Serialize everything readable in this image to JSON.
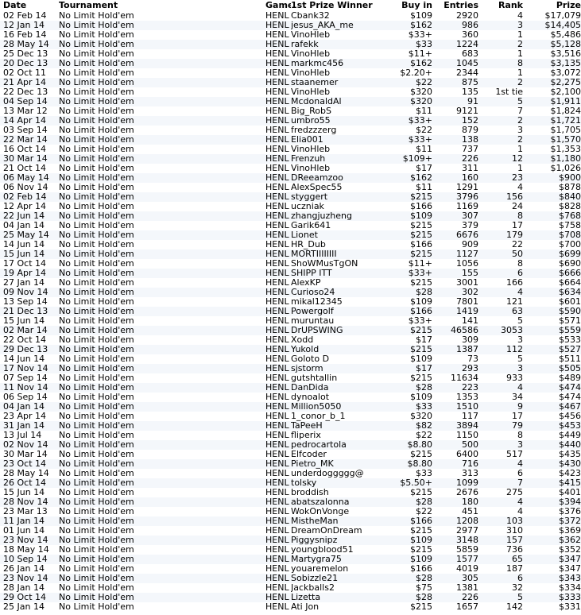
{
  "columns": [
    "Date",
    "Tournament",
    "Game",
    "1st Prize Winner",
    "Buy in",
    "Entries",
    "Rank",
    "Prize"
  ],
  "rows": [
    [
      "02 Feb 14",
      "No Limit Hold'em",
      "HENL",
      "Cbank32",
      "$109",
      "2920",
      "4",
      "$17,079"
    ],
    [
      "12 Jan 14",
      "No Limit Hold'em",
      "HENL",
      "jesus_AKA_me",
      "$162",
      "986",
      "3",
      "$14,405"
    ],
    [
      "16 Feb 14",
      "No Limit Hold'em",
      "HENL",
      "VinoHleb",
      "$33+",
      "360",
      "1",
      "$5,486"
    ],
    [
      "28 May 14",
      "No Limit Hold'em",
      "HENL",
      "rafekk",
      "$33",
      "1224",
      "2",
      "$5,128"
    ],
    [
      "25 Dec 13",
      "No Limit Hold'em",
      "HENL",
      "VinoHleb",
      "$11+",
      "683",
      "1",
      "$3,516"
    ],
    [
      "20 Dec 13",
      "No Limit Hold'em",
      "HENL",
      "markmc456",
      "$162",
      "1045",
      "8",
      "$3,135"
    ],
    [
      "02 Oct 11",
      "No Limit Hold'em",
      "HENL",
      "VinoHleb",
      "$2.20+",
      "2344",
      "1",
      "$3,072"
    ],
    [
      "21 Apr 14",
      "No Limit Hold'em",
      "HENL",
      "staanemer",
      "$22",
      "875",
      "2",
      "$2,275"
    ],
    [
      "22 Dec 13",
      "No Limit Hold'em",
      "HENL",
      "VinoHleb",
      "$320",
      "135",
      "1st tie",
      "$2,100"
    ],
    [
      "04 Sep 14",
      "No Limit Hold'em",
      "HENL",
      "McdonaldAl",
      "$320",
      "91",
      "5",
      "$1,911"
    ],
    [
      "13 Mar 12",
      "No Limit Hold'em",
      "HENL",
      "Big_RobS",
      "$11",
      "9121",
      "7",
      "$1,824"
    ],
    [
      "14 Apr 14",
      "No Limit Hold'em",
      "HENL",
      "umbro55",
      "$33+",
      "152",
      "2",
      "$1,721"
    ],
    [
      "03 Sep 14",
      "No Limit Hold'em",
      "HENL",
      "fredzzzerg",
      "$22",
      "879",
      "3",
      "$1,705"
    ],
    [
      "22 Mar 14",
      "No Limit Hold'em",
      "HENL",
      "Elia001",
      "$33+",
      "138",
      "2",
      "$1,570"
    ],
    [
      "16 Oct 14",
      "No Limit Hold'em",
      "HENL",
      "VinoHleb",
      "$11",
      "737",
      "1",
      "$1,353"
    ],
    [
      "30 Mar 14",
      "No Limit Hold'em",
      "HENL",
      "Frenzuh",
      "$109+",
      "226",
      "12",
      "$1,180"
    ],
    [
      "21 Oct 14",
      "No Limit Hold'em",
      "HENL",
      "VinoHleb",
      "$17",
      "311",
      "1",
      "$1,026"
    ],
    [
      "06 May 14",
      "No Limit Hold'em",
      "HENL",
      "DReeamzoo",
      "$162",
      "160",
      "23",
      "$900"
    ],
    [
      "06 Nov 14",
      "No Limit Hold'em",
      "HENL",
      "AlexSpec55",
      "$11",
      "1291",
      "4",
      "$878"
    ],
    [
      "02 Feb 14",
      "No Limit Hold'em",
      "HENL",
      "styggert",
      "$215",
      "3796",
      "156",
      "$840"
    ],
    [
      "12 Apr 14",
      "No Limit Hold'em",
      "HENL",
      "uczniak",
      "$166",
      "1169",
      "24",
      "$828"
    ],
    [
      "22 Jun 14",
      "No Limit Hold'em",
      "HENL",
      "zhangjuzheng",
      "$109",
      "307",
      "8",
      "$768"
    ],
    [
      "04 Jan 14",
      "No Limit Hold'em",
      "HENL",
      "Garik641",
      "$215",
      "379",
      "17",
      "$758"
    ],
    [
      "25 May 14",
      "No Limit Hold'em",
      "HENL",
      "Lionet",
      "$215",
      "6676",
      "179",
      "$708"
    ],
    [
      "14 Jun 14",
      "No Limit Hold'em",
      "HENL",
      "HR_Dub",
      "$166",
      "909",
      "22",
      "$700"
    ],
    [
      "15 Jun 14",
      "No Limit Hold'em",
      "HENL",
      "MORTIIIIIIII",
      "$215",
      "1127",
      "50",
      "$699"
    ],
    [
      "17 Oct 14",
      "No Limit Hold'em",
      "HENL",
      "ShoWMusTgON",
      "$11+",
      "1056",
      "8",
      "$690"
    ],
    [
      "19 Apr 14",
      "No Limit Hold'em",
      "HENL",
      "SHIPP ITT",
      "$33+",
      "155",
      "6",
      "$666"
    ],
    [
      "27 Jan 14",
      "No Limit Hold'em",
      "HENL",
      "AlexKP",
      "$215",
      "3001",
      "166",
      "$664"
    ],
    [
      "09 Nov 14",
      "No Limit Hold'em",
      "HENL",
      "Curioso24",
      "$28",
      "302",
      "4",
      "$634"
    ],
    [
      "13 Sep 14",
      "No Limit Hold'em",
      "HENL",
      "mikal12345",
      "$109",
      "7801",
      "121",
      "$601"
    ],
    [
      "21 Dec 13",
      "No Limit Hold'em",
      "HENL",
      "Powergolf",
      "$166",
      "1419",
      "63",
      "$590"
    ],
    [
      "15 Jun 14",
      "No Limit Hold'em",
      "HENL",
      "muruntau",
      "$33+",
      "141",
      "5",
      "$571"
    ],
    [
      "02 Mar 14",
      "No Limit Hold'em",
      "HENL",
      "DrUPSWING",
      "$215",
      "46586",
      "3053",
      "$559"
    ],
    [
      "22 Oct 14",
      "No Limit Hold'em",
      "HENL",
      "Xodd",
      "$17",
      "309",
      "3",
      "$533"
    ],
    [
      "29 Dec 13",
      "No Limit Hold'em",
      "HENL",
      "Yukold",
      "$215",
      "1387",
      "112",
      "$527"
    ],
    [
      "14 Jun 14",
      "No Limit Hold'em",
      "HENL",
      "Goloto D",
      "$109",
      "73",
      "5",
      "$511"
    ],
    [
      "17 Nov 14",
      "No Limit Hold'em",
      "HENL",
      "sjstorm",
      "$17",
      "293",
      "3",
      "$505"
    ],
    [
      "07 Sep 14",
      "No Limit Hold'em",
      "HENL",
      "gutshtallin",
      "$215",
      "11634",
      "933",
      "$489"
    ],
    [
      "11 Nov 14",
      "No Limit Hold'em",
      "HENL",
      "DanDida",
      "$28",
      "223",
      "4",
      "$474"
    ],
    [
      "06 Sep 14",
      "No Limit Hold'em",
      "HENL",
      "dynoalot",
      "$109",
      "1353",
      "34",
      "$474"
    ],
    [
      "04 Jan 14",
      "No Limit Hold'em",
      "HENL",
      "Million5050",
      "$33",
      "1510",
      "9",
      "$467"
    ],
    [
      "23 Apr 14",
      "No Limit Hold'em",
      "HENL",
      "1_conor_b_1",
      "$320",
      "117",
      "17",
      "$456"
    ],
    [
      "31 Jan 14",
      "No Limit Hold'em",
      "HENL",
      "TaPeeH",
      "$82",
      "3894",
      "79",
      "$453"
    ],
    [
      "13 Jul 14",
      "No Limit Hold'em",
      "HENL",
      "fliperix",
      "$22",
      "1150",
      "8",
      "$449"
    ],
    [
      "02 Nov 14",
      "No Limit Hold'em",
      "HENL",
      "pedrocartola",
      "$8.80",
      "500",
      "3",
      "$440"
    ],
    [
      "30 Mar 14",
      "No Limit Hold'em",
      "HENL",
      "Elfcoder",
      "$215",
      "6400",
      "517",
      "$435"
    ],
    [
      "23 Oct 14",
      "No Limit Hold'em",
      "HENL",
      "Pietro_MK",
      "$8.80",
      "716",
      "4",
      "$430"
    ],
    [
      "28 May 14",
      "No Limit Hold'em",
      "HENL",
      "underdoggggg@",
      "$33",
      "313",
      "6",
      "$423"
    ],
    [
      "26 Oct 14",
      "No Limit Hold'em",
      "HENL",
      "tolsky",
      "$5.50+",
      "1099",
      "7",
      "$415"
    ],
    [
      "15 Jun 14",
      "No Limit Hold'em",
      "HENL",
      "broddish",
      "$215",
      "2676",
      "275",
      "$401"
    ],
    [
      "28 Nov 14",
      "No Limit Hold'em",
      "HENL",
      "abatszalonna",
      "$28",
      "180",
      "4",
      "$394"
    ],
    [
      "23 Mar 13",
      "No Limit Hold'em",
      "HENL",
      "WokOnVonge",
      "$22",
      "451",
      "4",
      "$376"
    ],
    [
      "11 Jan 14",
      "No Limit Hold'em",
      "HENL",
      "MistheMan",
      "$166",
      "1208",
      "103",
      "$372"
    ],
    [
      "01 Jun 14",
      "No Limit Hold'em",
      "HENL",
      "DreamOnDream",
      "$215",
      "2977",
      "310",
      "$369"
    ],
    [
      "23 Nov 14",
      "No Limit Hold'em",
      "HENL",
      "Piggysnipz",
      "$109",
      "3148",
      "157",
      "$362"
    ],
    [
      "18 May 14",
      "No Limit Hold'em",
      "HENL",
      "youngblood51",
      "$215",
      "5859",
      "736",
      "$352"
    ],
    [
      "10 Sep 14",
      "No Limit Hold'em",
      "HENL",
      "Martygra75",
      "$109",
      "1577",
      "65",
      "$347"
    ],
    [
      "26 Jan 14",
      "No Limit Hold'em",
      "HENL",
      "youaremelon",
      "$166",
      "4019",
      "187",
      "$347"
    ],
    [
      "23 Nov 14",
      "No Limit Hold'em",
      "HENL",
      "Sobizzle21",
      "$28",
      "305",
      "6",
      "$343"
    ],
    [
      "28 Jan 14",
      "No Limit Hold'em",
      "HENL",
      "Jackballs2",
      "$75",
      "1381",
      "32",
      "$334"
    ],
    [
      "29 Oct 14",
      "No Limit Hold'em",
      "HENL",
      "Lizetta",
      "$28",
      "226",
      "5",
      "$333"
    ],
    [
      "25 Jan 14",
      "No Limit Hold'em",
      "HENL",
      "Ati Jon",
      "$215",
      "1657",
      "142",
      "$331"
    ]
  ]
}
